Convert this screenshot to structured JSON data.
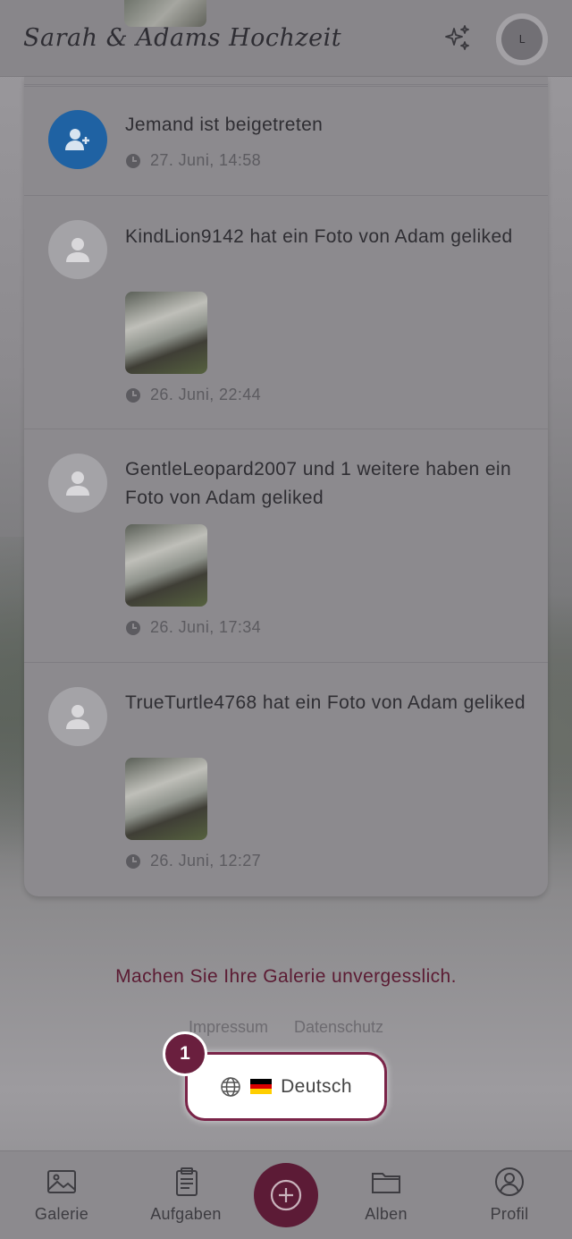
{
  "header": {
    "title": "Sarah & Adams Hochzeit",
    "avatar_initial": "L"
  },
  "activity": [
    {
      "text": "Jemand ist beigetreten",
      "time": "27. Juni, 14:58",
      "has_photo": false,
      "avatar": "user-plus-icon"
    },
    {
      "text": "KindLion9142 hat ein Foto von Adam geliked",
      "time": "26. Juni, 22:44",
      "has_photo": true,
      "avatar": "user-icon"
    },
    {
      "text": "GentleLeopard2007 und 1 weitere haben ein Foto von Adam geliked",
      "time": "26. Juni, 17:34",
      "has_photo": true,
      "avatar": "user-icon"
    },
    {
      "text": "TrueTurtle4768 hat ein Foto von Adam geliked",
      "time": "26. Juni, 12:27",
      "has_photo": true,
      "avatar": "user-icon"
    }
  ],
  "footer": {
    "tagline": "Machen Sie Ihre Galerie unvergesslich.",
    "links": [
      "Impressum",
      "Datenschutz"
    ],
    "language": "Deutsch",
    "badge": "1"
  },
  "nav": {
    "items": [
      "Galerie",
      "Aufgaben",
      "Alben",
      "Profil"
    ]
  },
  "colors": {
    "accent": "#5c1b36",
    "badge": "#6a1f3e",
    "join_avatar": "#1f62a3"
  }
}
